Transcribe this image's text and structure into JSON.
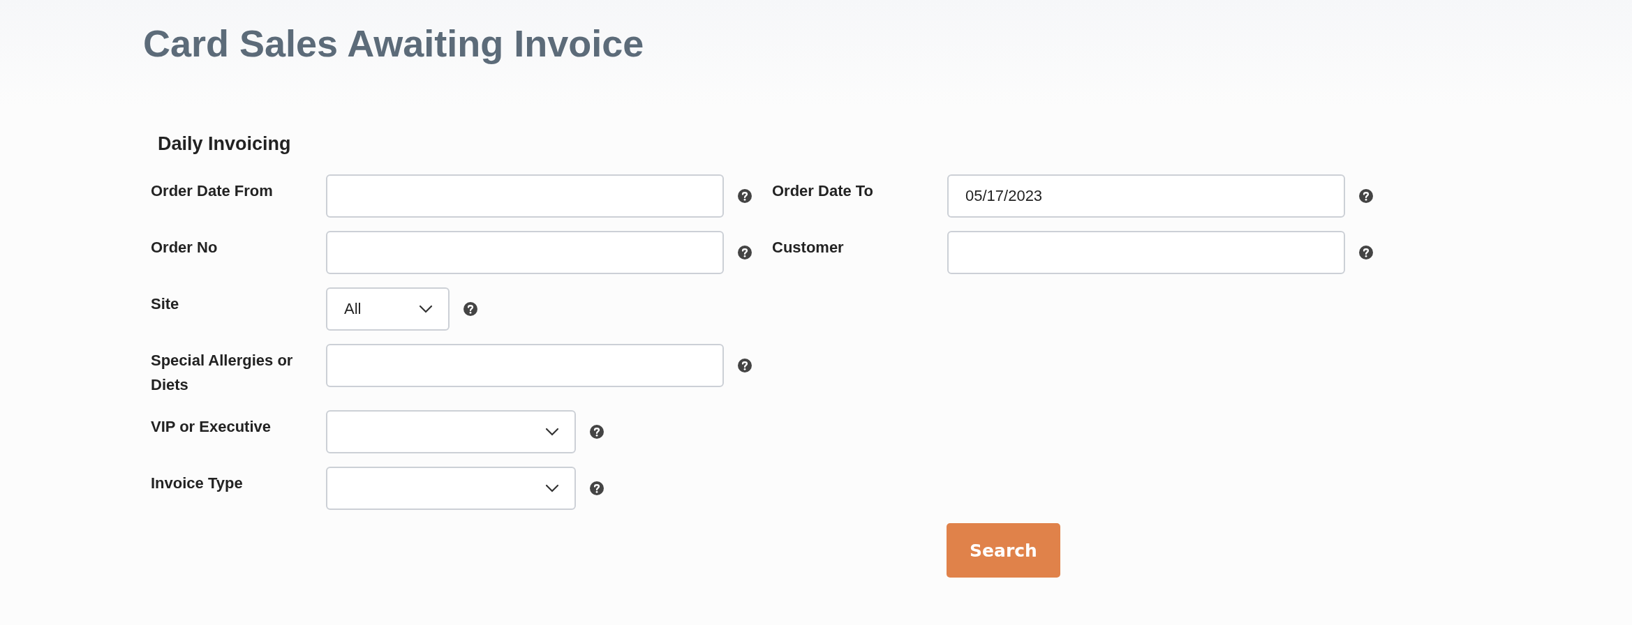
{
  "title": "Card Sales Awaiting Invoice",
  "section": "Daily Invoicing",
  "rows": [
    {
      "fields": [
        {
          "label": "Order Date From",
          "kind": "text"
        },
        {
          "label": "Order Date To",
          "kind": "text",
          "value": "05/17/2023"
        }
      ]
    },
    {
      "fields": [
        {
          "label": "Order No",
          "kind": "text"
        },
        {
          "label": "Customer",
          "kind": "text"
        }
      ]
    },
    {
      "fields": [
        {
          "label": "Site",
          "kind": "select",
          "value": "All"
        }
      ]
    },
    {
      "fields": [
        {
          "label": "Special Allergies or Diets",
          "kind": "text"
        }
      ]
    },
    {
      "fields": [
        {
          "label": "VIP or Executive",
          "kind": "select"
        }
      ]
    },
    {
      "fields": [
        {
          "label": "Invoice Type",
          "kind": "select"
        }
      ]
    }
  ],
  "search_button": "Search"
}
